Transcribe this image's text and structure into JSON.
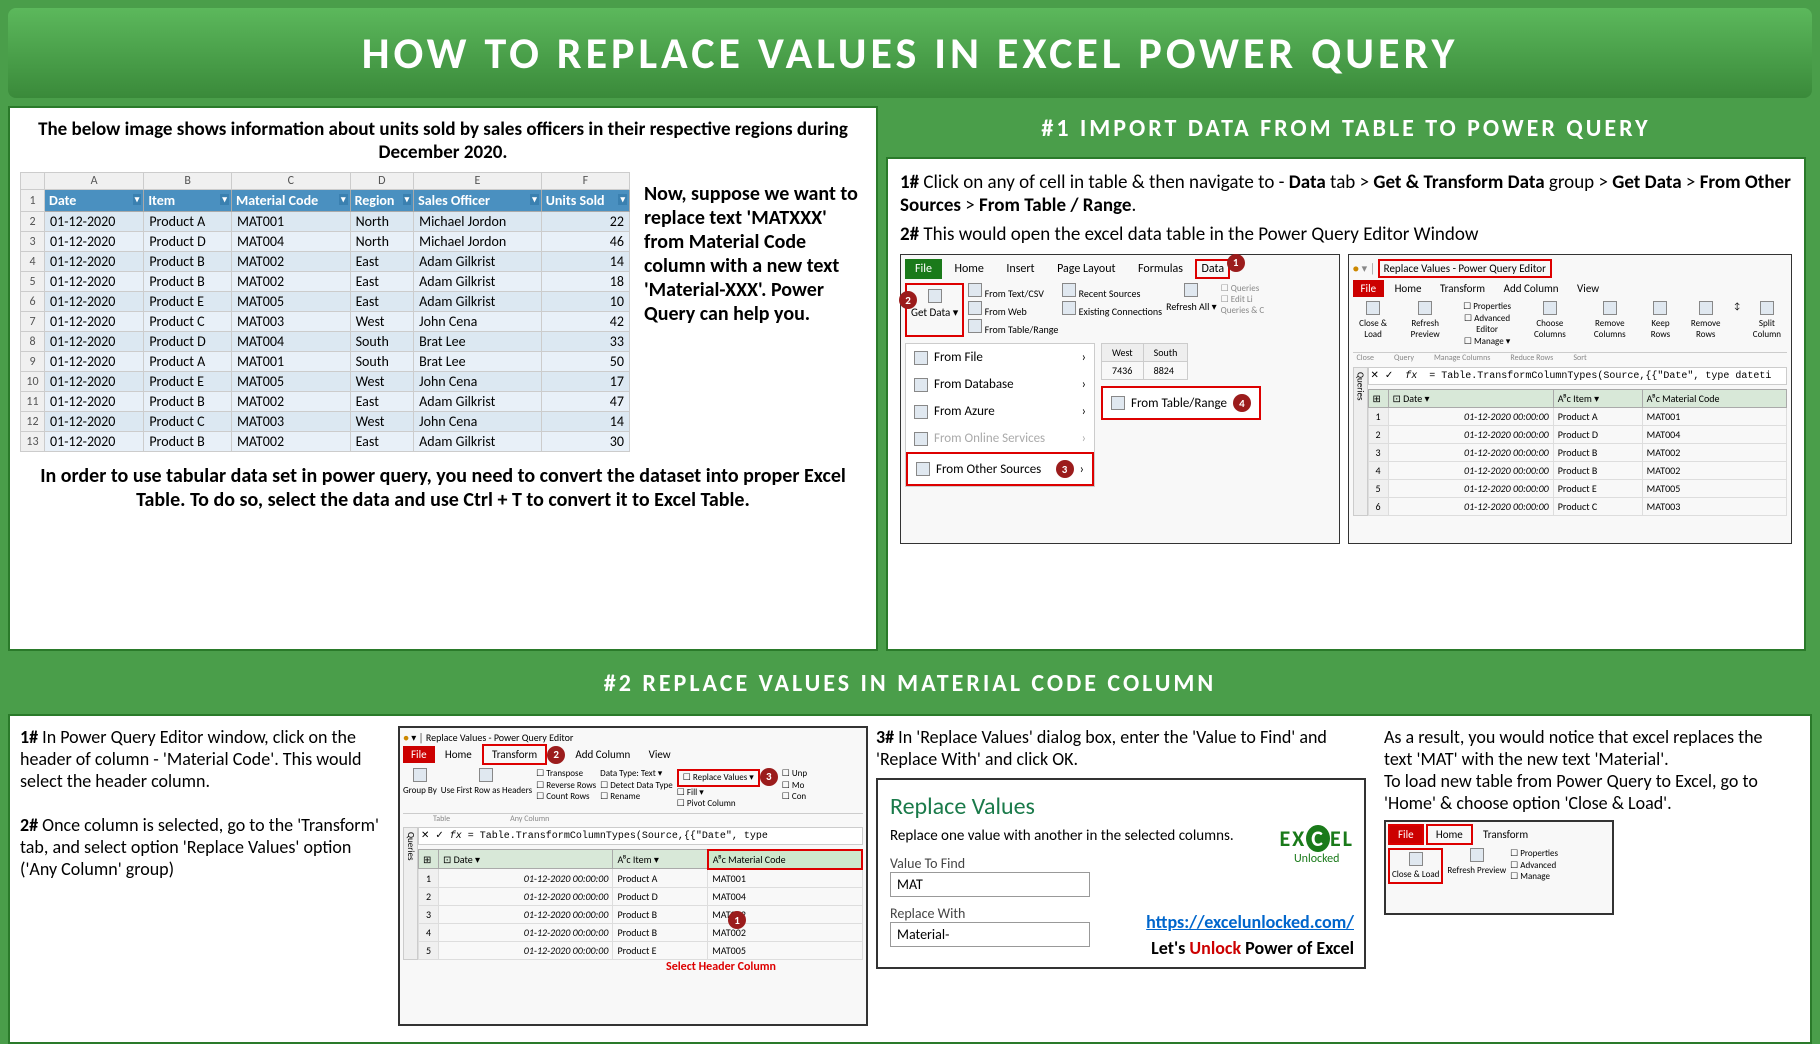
{
  "title": "HOW TO REPLACE VALUES IN EXCEL POWER QUERY",
  "intro": "The below image shows information about units sold by sales officers in their respective regions during December 2020.",
  "columns_letters": [
    "A",
    "B",
    "C",
    "D",
    "E",
    "F"
  ],
  "table_headers": [
    "Date",
    "Item",
    "Material Code",
    "Region",
    "Sales Officer",
    "Units Sold"
  ],
  "table_rows": [
    [
      "01-12-2020",
      "Product A",
      "MAT001",
      "North",
      "Michael Jordon",
      "22"
    ],
    [
      "01-12-2020",
      "Product D",
      "MAT004",
      "North",
      "Michael Jordon",
      "46"
    ],
    [
      "01-12-2020",
      "Product B",
      "MAT002",
      "East",
      "Adam Gilkrist",
      "14"
    ],
    [
      "01-12-2020",
      "Product B",
      "MAT002",
      "East",
      "Adam Gilkrist",
      "18"
    ],
    [
      "01-12-2020",
      "Product E",
      "MAT005",
      "East",
      "Adam Gilkrist",
      "10"
    ],
    [
      "01-12-2020",
      "Product C",
      "MAT003",
      "West",
      "John Cena",
      "42"
    ],
    [
      "01-12-2020",
      "Product D",
      "MAT004",
      "South",
      "Brat Lee",
      "33"
    ],
    [
      "01-12-2020",
      "Product A",
      "MAT001",
      "South",
      "Brat Lee",
      "50"
    ],
    [
      "01-12-2020",
      "Product E",
      "MAT005",
      "West",
      "John Cena",
      "17"
    ],
    [
      "01-12-2020",
      "Product B",
      "MAT002",
      "East",
      "Adam Gilkrist",
      "47"
    ],
    [
      "01-12-2020",
      "Product C",
      "MAT003",
      "West",
      "John Cena",
      "14"
    ],
    [
      "01-12-2020",
      "Product B",
      "MAT002",
      "East",
      "Adam Gilkrist",
      "30"
    ]
  ],
  "side_note": "Now, suppose we want to replace text 'MATXXX' from Material Code column with a new text 'Material-XXX'. Power Query can help you.",
  "convert_note": "In order to use tabular data set in power query, you need to convert the dataset into proper Excel Table. To do so, select the data and use Ctrl + T to convert it to Excel Table.",
  "section1": {
    "header": "#1 IMPORT DATA FROM TABLE TO POWER QUERY",
    "step1_prefix": "1#",
    "step1": " Click on any of cell in table & then navigate to - ",
    "step1_b1": "Data",
    "step1_t1": " tab > ",
    "step1_b2": "Get & Transform Data",
    "step1_t2": " group > ",
    "step1_b3": "Get Data",
    "step1_t3": " > ",
    "step1_b4": "From Other Sources",
    "step1_t4": " > ",
    "step1_b5": "From Table / Range",
    "step1_end": ".",
    "step2_prefix": "2#",
    "step2": " This would open the excel data table in the Power Query Editor Window"
  },
  "ribbon1": {
    "tabs": [
      "File",
      "Home",
      "Insert",
      "Page Layout",
      "Formulas",
      "Data"
    ],
    "get_data": "Get Data",
    "items": [
      "From Text/CSV",
      "From Web",
      "From Table/Range",
      "Recent Sources",
      "Existing Connections",
      "Refresh All"
    ],
    "submenu": [
      "From File",
      "From Database",
      "From Azure",
      "From Online Services",
      "From Other Sources"
    ],
    "from_table": "From Table/Range",
    "mini_hdr": [
      "West",
      "South"
    ],
    "mini_vals": [
      "7436",
      "8824"
    ]
  },
  "ribbon2": {
    "title": "Replace Values - Power Query Editor",
    "tabs": [
      "File",
      "Home",
      "Transform",
      "Add Column",
      "View"
    ],
    "btns": [
      "Close & Load",
      "Refresh Preview",
      "Manage",
      "Properties",
      "Advanced Editor",
      "Choose Columns",
      "Remove Columns",
      "Keep Rows",
      "Remove Rows",
      "Split Column"
    ],
    "groups": [
      "Close",
      "Query",
      "Manage Columns",
      "Reduce Rows",
      "Sort"
    ],
    "formula": "= Table.TransformColumnTypes(Source,{{\"Date\", type dateti",
    "grid_headers": [
      "Date",
      "Item",
      "Material Code"
    ],
    "grid_rows": [
      [
        "1",
        "01-12-2020 00:00:00",
        "Product A",
        "MAT001"
      ],
      [
        "2",
        "01-12-2020 00:00:00",
        "Product D",
        "MAT004"
      ],
      [
        "3",
        "01-12-2020 00:00:00",
        "Product B",
        "MAT002"
      ],
      [
        "4",
        "01-12-2020 00:00:00",
        "Product B",
        "MAT002"
      ],
      [
        "5",
        "01-12-2020 00:00:00",
        "Product E",
        "MAT005"
      ],
      [
        "6",
        "01-12-2020 00:00:00",
        "Product C",
        "MAT003"
      ]
    ]
  },
  "section2_header": "#2 REPLACE VALUES IN MATERIAL CODE COLUMN",
  "s2a": {
    "p1_prefix": "1#",
    "p1": " In Power Query Editor window, click on the header of column - 'Material Code'. This would select the header column.",
    "p2_prefix": "2#",
    "p2": " Once column is selected, go to the 'Transform' tab, and select option 'Replace Values' option ('Any Column' group)"
  },
  "s2b": {
    "title": "Replace Values - Power Query Editor",
    "tabs": [
      "File",
      "Home",
      "Transform",
      "Add Column",
      "View"
    ],
    "btns": [
      "Group By",
      "Use First Row as Headers",
      "Transpose",
      "Reverse Rows",
      "Count Rows",
      "Data Type: Text",
      "Detect Data Type",
      "Rename",
      "Replace Values",
      "Fill",
      "Pivot Column",
      "Unp",
      "Mo",
      "Con"
    ],
    "groups": [
      "Table",
      "Any Column"
    ],
    "formula": "= Table.TransformColumnTypes(Source,{{\"Date\", type",
    "callout": "Select Header Column",
    "grid_rows": [
      [
        "1",
        "01-12-2020 00:00:00",
        "Product A",
        "MAT001"
      ],
      [
        "2",
        "01-12-2020 00:00:00",
        "Product D",
        "MAT004"
      ],
      [
        "3",
        "01-12-2020 00:00:00",
        "Product B",
        "MAT002"
      ],
      [
        "4",
        "01-12-2020 00:00:00",
        "Product B",
        "MAT002"
      ],
      [
        "5",
        "01-12-2020 00:00:00",
        "Product E",
        "MAT005"
      ]
    ]
  },
  "s2c": {
    "p_prefix": "3#",
    "p": " In 'Replace Values' dialog box, enter the 'Value to Find' and 'Replace With' and click OK.",
    "dialog_title": "Replace Values",
    "dialog_sub": "Replace one value with another in the selected columns.",
    "find_label": "Value To Find",
    "find_value": "MAT",
    "replace_label": "Replace With",
    "replace_value": "Material-",
    "logo": "EX  EL",
    "logo_sub": "Unlocked",
    "url": "https://excelunlocked.com/",
    "tagline_a": "Let's ",
    "tagline_b": "Unlock",
    "tagline_c": " Power of Excel"
  },
  "s2d": {
    "p": "As a result, you would notice that excel replaces the text 'MAT' with the new text 'Material'.\nTo load new table from Power Query to Excel, go to 'Home' & choose option 'Close & Load'.",
    "tabs": [
      "File",
      "Home",
      "Transform"
    ],
    "btns": [
      "Close & Load",
      "Refresh Preview",
      "Properties",
      "Advanced",
      "Manage"
    ]
  }
}
